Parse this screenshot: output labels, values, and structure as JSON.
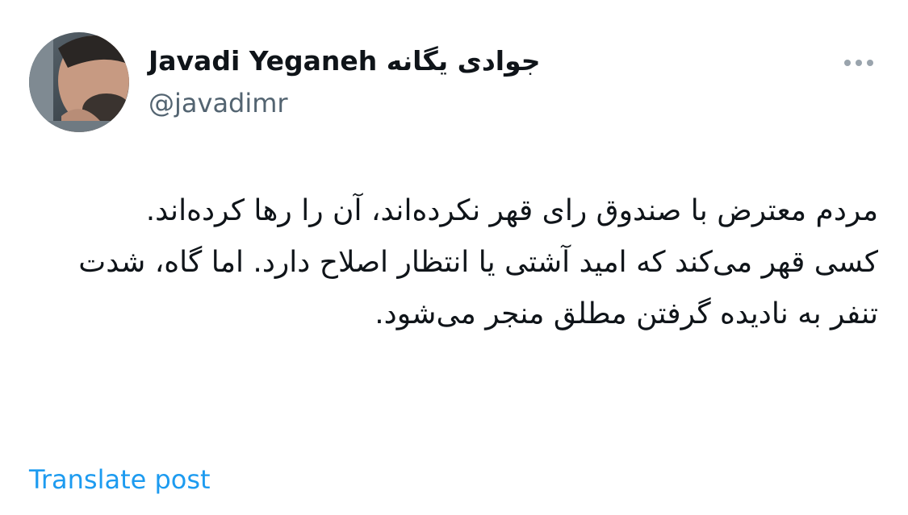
{
  "tweet": {
    "author": {
      "display_name": "Javadi Yeganeh جوادی یگانه",
      "handle": "@javadimr",
      "avatar_icon": "profile-photo"
    },
    "more_icon": "more-horizontal-icon",
    "text": "مردم معترض با صندوق رای قهر نکرده‌اند، آن را رها کرده‌اند.\nکسی قهر می‌کند که امید آشتی یا انتظار اصلاح دارد. اما گاه، شدت تنفر به نادیده گرفتن مطلق منجر می‌شود.",
    "translate_label": "Translate post"
  },
  "colors": {
    "text_primary": "#0f1419",
    "text_secondary": "#536471",
    "link": "#1d9bf0",
    "icon_gray": "#9aa4ad"
  }
}
